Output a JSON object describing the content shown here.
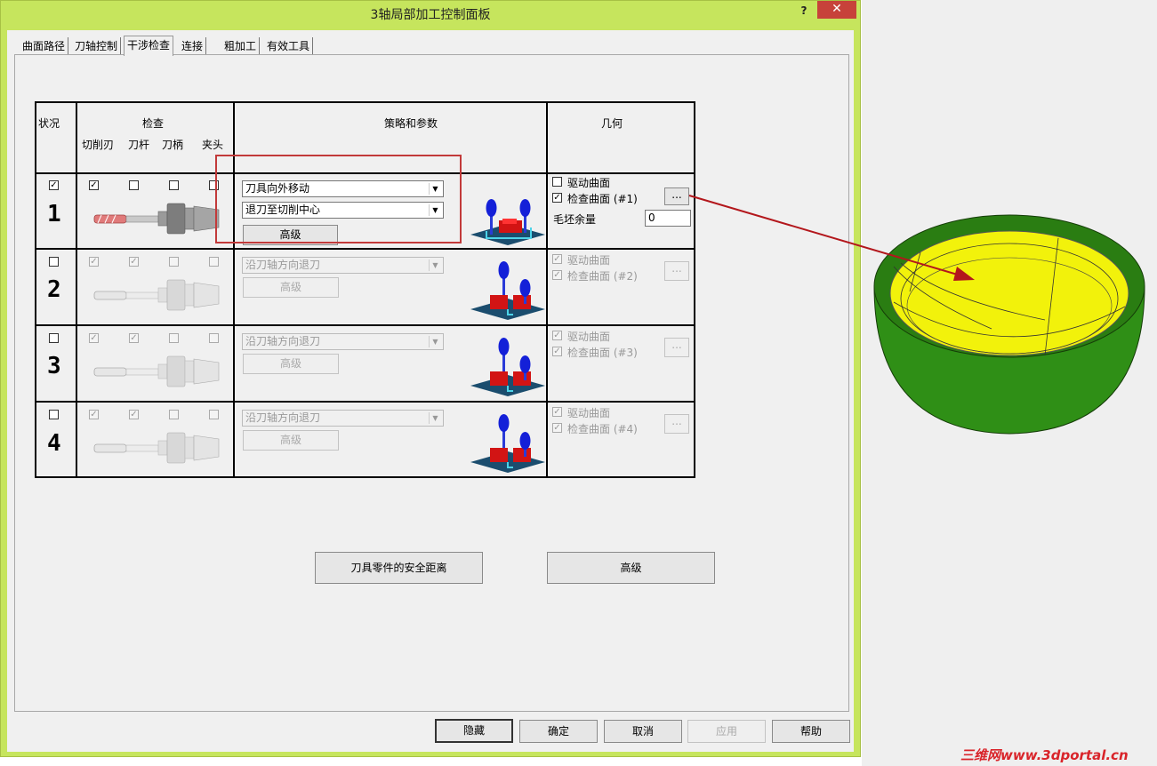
{
  "window": {
    "title": "3轴局部加工控制面板",
    "help": "?",
    "close": "✕"
  },
  "tabs": [
    "曲面路径",
    "刀轴控制",
    "干涉检查",
    "连接",
    "粗加工",
    "有效工具"
  ],
  "active_tab": 2,
  "table": {
    "headers": {
      "status": "状况",
      "check": "检查",
      "strategy": "策略和参数",
      "geometry": "几何"
    },
    "sub_headers": [
      "切削刃",
      "刀杆",
      "刀柄",
      "夹头"
    ],
    "rows": [
      {
        "num": "1",
        "status_checked": true,
        "checks": [
          true,
          false,
          false,
          false
        ],
        "select1": "刀具向外移动",
        "select2": "退刀至切削中心",
        "advanced": "高级",
        "geo": {
          "drive": "驱动曲面",
          "drive_checked": false,
          "check": "检查曲面 (#1)",
          "check_checked": true,
          "stock_label": "毛坯余量",
          "stock_value": "0",
          "more": "..."
        }
      },
      {
        "num": "2",
        "status_checked": false,
        "checks": [
          true,
          true,
          false,
          false
        ],
        "select1": "沿刀轴方向退刀",
        "advanced": "高级",
        "geo": {
          "drive": "驱动曲面",
          "check": "检查曲面 (#2)",
          "more": "..."
        }
      },
      {
        "num": "3",
        "status_checked": false,
        "checks": [
          true,
          true,
          false,
          false
        ],
        "select1": "沿刀轴方向退刀",
        "advanced": "高级",
        "geo": {
          "drive": "驱动曲面",
          "check": "检查曲面 (#3)",
          "more": "..."
        }
      },
      {
        "num": "4",
        "status_checked": false,
        "checks": [
          true,
          true,
          false,
          false
        ],
        "select1": "沿刀轴方向退刀",
        "advanced": "高级",
        "geo": {
          "drive": "驱动曲面",
          "check": "检查曲面 (#4)",
          "more": "..."
        }
      }
    ]
  },
  "panel_buttons": {
    "clearance": "刀具零件的安全距离",
    "advanced": "高级"
  },
  "footer_buttons": {
    "hide": "隐藏",
    "ok": "确定",
    "cancel": "取消",
    "apply": "应用",
    "help": "帮助"
  },
  "watermark": "三维网www.3dportal.cn",
  "colors": {
    "window_frame": "#c6e55d",
    "highlight_box": "#c23a3a",
    "arrow": "#b3171c",
    "bowl_outer": "#2f8f16",
    "bowl_inner": "#f2f20b"
  }
}
